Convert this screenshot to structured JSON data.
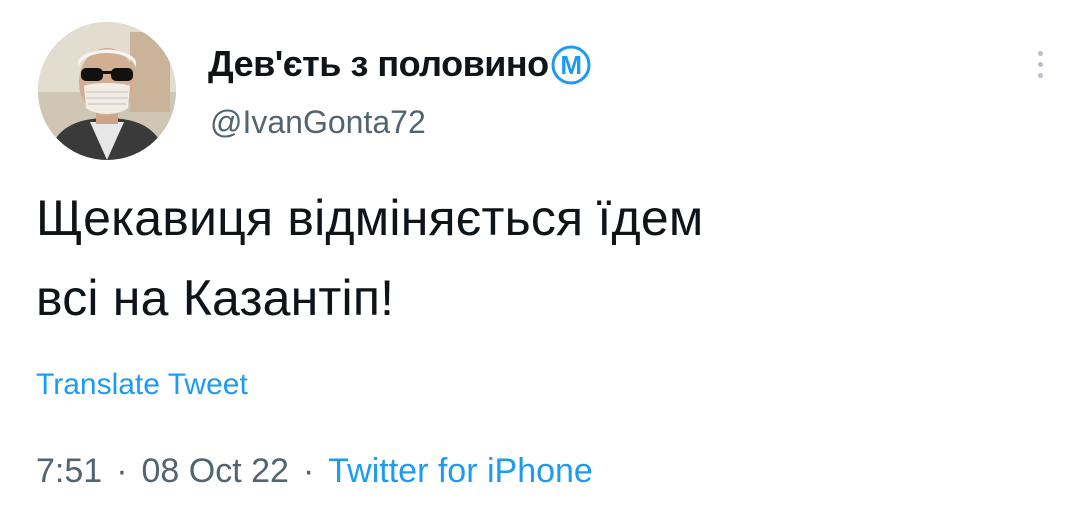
{
  "tweet": {
    "display_name": "Дев'єть з половино",
    "badge_letter": "M",
    "handle": "@IvanGonta72",
    "text_line1": "Щекавиця відміняється їдем",
    "text_line2": "всі на Казантіп!",
    "translate_label": "Translate Tweet",
    "time": "7:51",
    "date": "08 Oct 22",
    "separator": "·",
    "source": "Twitter for iPhone"
  },
  "colors": {
    "text": "#0f1419",
    "secondary": "#536471",
    "link": "#1d9bf0",
    "badge": "#1d9bf0"
  },
  "icons": {
    "more": "more-vertical-icon",
    "badge": "m-circle-badge-icon"
  }
}
